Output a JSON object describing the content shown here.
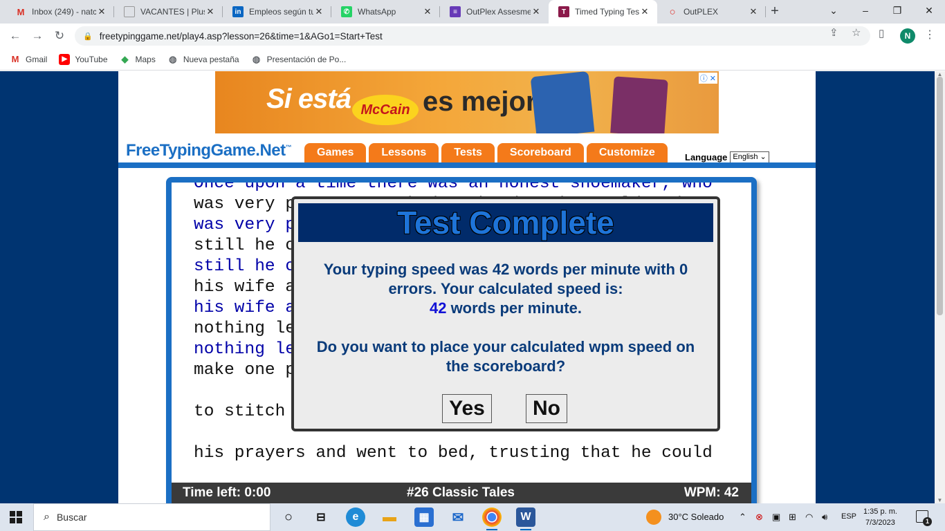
{
  "browser": {
    "tabs": [
      {
        "title": "Inbox (249) - natc",
        "icon": "gmail-icon",
        "color": "#d93025",
        "glyph": "M"
      },
      {
        "title": "VACANTES | PlusE",
        "icon": "page-icon",
        "color": "#888888",
        "glyph": ""
      },
      {
        "title": "Empleos según tu",
        "icon": "linkedin-icon",
        "color": "#0a66c2",
        "glyph": "in"
      },
      {
        "title": "WhatsApp",
        "icon": "whatsapp-icon",
        "color": "#25d366",
        "glyph": "✆"
      },
      {
        "title": "OutPlex Assesme",
        "icon": "forms-icon",
        "color": "#673ab7",
        "glyph": "≡"
      },
      {
        "title": "Timed Typing Tes",
        "icon": "typing-site-icon",
        "color": "#8b1a4a",
        "glyph": "T"
      },
      {
        "title": "OutPLEX",
        "icon": "oracle-icon",
        "color": "#e0312c",
        "glyph": "○"
      }
    ],
    "active_tab": 5,
    "url": "freetypinggame.net/play4.asp?lesson=26&time=1&AGo1=Start+Test",
    "profile_initial": "N",
    "bookmarks": [
      {
        "label": "Gmail",
        "icon": "gmail-icon",
        "color": "#d93025",
        "glyph": "M"
      },
      {
        "label": "YouTube",
        "icon": "youtube-icon",
        "color": "#ff0000",
        "glyph": "▶"
      },
      {
        "label": "Maps",
        "icon": "maps-icon",
        "color": "#34a853",
        "glyph": "◆"
      },
      {
        "label": "Nueva pestaña",
        "icon": "globe-icon",
        "color": "#5f6368",
        "glyph": "◍"
      },
      {
        "label": "Presentación de Po...",
        "icon": "globe-icon",
        "color": "#5f6368",
        "glyph": "◍"
      }
    ]
  },
  "ad": {
    "slogan_left": "Si está",
    "brand": "McCain",
    "slogan_right": "es mejor"
  },
  "site": {
    "logo": "FreeTypingGame.Net",
    "logo_mark": "™",
    "nav": [
      "Games",
      "Lessons",
      "Tests",
      "Scoreboard",
      "Customize"
    ],
    "language_label": "Language",
    "language_value": "English"
  },
  "typing_text": [
    {
      "text": "Once upon a time there was an honest shoemaker, who",
      "style": "blue"
    },
    {
      "text": "was very poor. He worked as hard as he could and",
      "style": "black"
    },
    {
      "text": "was very poor. He worked as hard as he could and",
      "style": "blue"
    },
    {
      "text": "still he could not earn enough to live on, and",
      "style": "black"
    },
    {
      "text": "still he could not earn enough to live on, and",
      "style": "blue"
    },
    {
      "text": "his wife and children were hungry. He had",
      "style": "black"
    },
    {
      "text": "his wife and children were hungry. He had",
      "style": "blue"
    },
    {
      "text": "nothing left in the world but leather enough to",
      "style": "black"
    },
    {
      "text": "nothing left in the world but leather enough to",
      "style": "blue"
    },
    {
      "text": "make one pair of shoes. He cut them out, ready",
      "style": "black"
    },
    {
      "text": "",
      "style": "blue"
    },
    {
      "text": "to stitch them in the morning. Then he said",
      "style": "black"
    },
    {
      "text": "",
      "style": "blue"
    },
    {
      "text": "his prayers and went to bed, trusting that he could",
      "style": "black"
    }
  ],
  "status": {
    "time_left": "Time left: 0:00",
    "lesson": "#26 Classic Tales",
    "wpm": "WPM: 42"
  },
  "modal": {
    "title": "Test Complete",
    "line1": "Your typing speed was 42 words per minute with 0",
    "line2": "errors. Your calculated speed is:",
    "speed_value": "42",
    "speed_unit": "words per minute.",
    "question_line1": "Do you want to place your calculated wpm speed on",
    "question_line2": "the scoreboard?",
    "yes": "Yes",
    "no": "No"
  },
  "taskbar": {
    "search_placeholder": "Buscar",
    "weather": "30°C  Soleado",
    "language": "ESP",
    "time": "1:35 p. m.",
    "date": "7/3/2023",
    "notifications": "1"
  }
}
